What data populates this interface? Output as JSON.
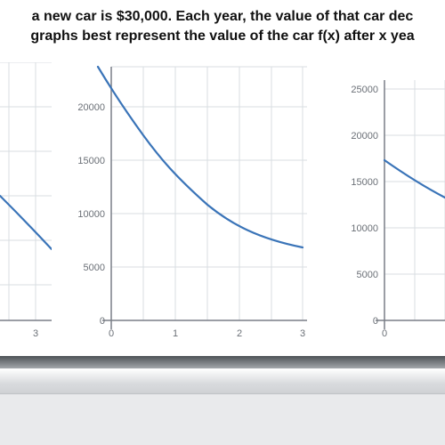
{
  "question": {
    "line1": "a new car is $30,000. Each year, the value of that car dec",
    "line2": "graphs best represent the value of the car f(x) after x yea"
  },
  "chart_data": [
    {
      "type": "line",
      "title": "",
      "xlabel": "",
      "ylabel": "",
      "xlim": [
        2.5,
        3.2
      ],
      "ylim": [
        0,
        25000
      ],
      "x_ticks": [
        3
      ],
      "y_ticks": [],
      "series": [
        {
          "name": "f(x)",
          "x": [
            2.5,
            3.2
          ],
          "values": [
            19000,
            14500
          ]
        }
      ],
      "note": "left partial graph, mostly cropped; only tail of a decreasing curve and x-tick 3 visible"
    },
    {
      "type": "line",
      "title": "",
      "xlabel": "",
      "ylabel": "",
      "xlim": [
        0,
        3
      ],
      "ylim": [
        0,
        23000
      ],
      "x_ticks": [
        0,
        1,
        2,
        3
      ],
      "y_ticks": [
        0,
        5000,
        10000,
        15000,
        20000
      ],
      "series": [
        {
          "name": "f(x)",
          "x": [
            0,
            0.5,
            1,
            1.5,
            2,
            2.5,
            3
          ],
          "values": [
            23000,
            19000,
            15800,
            13100,
            11000,
            9600,
            8600
          ]
        }
      ]
    },
    {
      "type": "line",
      "title": "",
      "xlabel": "",
      "ylabel": "",
      "xlim": [
        0,
        0.8
      ],
      "ylim": [
        0,
        27000
      ],
      "x_ticks": [
        0
      ],
      "y_ticks": [
        0,
        5000,
        10000,
        15000,
        20000,
        25000
      ],
      "series": [
        {
          "name": "f(x)",
          "x": [
            0,
            0.4,
            0.8
          ],
          "values": [
            17500,
            15500,
            13800
          ]
        }
      ],
      "note": "right partial graph, cropped on the right; only left portion visible"
    }
  ]
}
